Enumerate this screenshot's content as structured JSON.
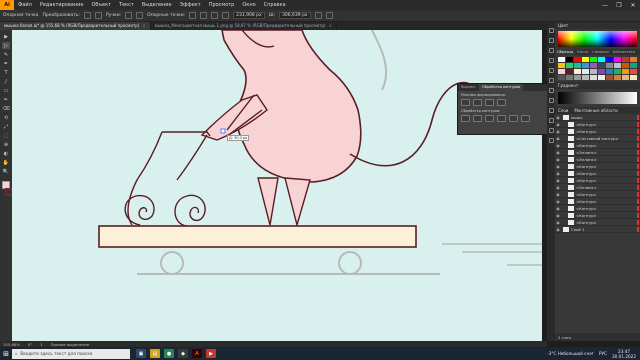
{
  "menubar": {
    "app_logo": "Ai",
    "items": [
      "Файл",
      "Редактирование",
      "Объект",
      "Текст",
      "Выделение",
      "Эффект",
      "Просмотр",
      "Окно",
      "Справка"
    ],
    "controls": [
      "—",
      "❐",
      "✕"
    ]
  },
  "ctrlbar": {
    "labels": [
      "Опорная точка",
      "Преобразовать:",
      "Ручки:",
      "Опорные точки:"
    ],
    "fields": [
      "231,908 px",
      "306,639 px"
    ],
    "unit_label": "Ш:"
  },
  "doctabs": [
    {
      "label": "мышка белая.ai* @ 155,68 % (RGB/Предварительный просмотр)",
      "close": "×",
      "active": true
    },
    {
      "label": "мышка_Многоцветная мышь 1.png @ 58,97 % (RGB/Предварительный просмотр)",
      "close": "×",
      "active": false
    }
  ],
  "tools": [
    "▶",
    "▷",
    "✎",
    "✒",
    "T",
    "/",
    "▭",
    "✏",
    "⌫",
    "⟲",
    "⤢",
    "⬚",
    "⊕",
    "◐",
    "✋",
    "🔍"
  ],
  "canvas": {
    "tooltip": "Д: 30,0 px",
    "colors": {
      "background": "#d8f1ef",
      "body": "#f7d3d6",
      "outline": "#5a1e24",
      "board": "#fdf0d8",
      "guide": "#b9b9b9"
    }
  },
  "floating_panel": {
    "tabs": [
      "Выравн.",
      "Обработка контуров"
    ],
    "label_shapes": "Режимы формирования:",
    "label_pathfinder": "Обработка контуров:"
  },
  "right_panel": {
    "color_title": "Цвет",
    "swatch_tabs": [
      "Образцы",
      "Кисти",
      "Символы",
      "Библиотеки"
    ],
    "gradient_title": "Градиент",
    "layers_tabs": [
      "Слои",
      "Монтажные области"
    ],
    "layers": [
      {
        "name": "мышь",
        "level": 0
      },
      {
        "name": "<Контур>",
        "level": 1
      },
      {
        "name": "<Контур>",
        "level": 1
      },
      {
        "name": "<Составной контур>",
        "level": 1
      },
      {
        "name": "<Контур>",
        "level": 1
      },
      {
        "name": "<Эллипс>",
        "level": 1
      },
      {
        "name": "<Эллипс>",
        "level": 1
      },
      {
        "name": "<Контур>",
        "level": 1
      },
      {
        "name": "<Контур>",
        "level": 1
      },
      {
        "name": "<Контур>",
        "level": 1
      },
      {
        "name": "<Эллипс>",
        "level": 1
      },
      {
        "name": "<Контур>",
        "level": 1
      },
      {
        "name": "<Контур>",
        "level": 1
      },
      {
        "name": "<Контур>",
        "level": 1
      },
      {
        "name": "<Контур>",
        "level": 1
      },
      {
        "name": "<Контур>",
        "level": 1
      },
      {
        "name": "Слой 1",
        "level": 0
      }
    ],
    "footer": "2 слоя"
  },
  "statusbar": {
    "zoom": "155,68%",
    "angle": "0°",
    "page": "1",
    "tool": "Прямое выделение"
  },
  "taskbar": {
    "search_placeholder": "Введите здесь текст для поиска",
    "weather": "-3°C  Небольшой снег",
    "lang": "РУС",
    "time": "23:47",
    "date": "30.01.2022"
  }
}
